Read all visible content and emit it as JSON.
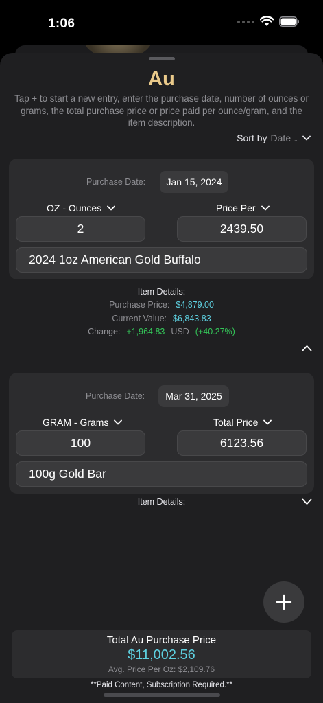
{
  "status_bar": {
    "time": "1:06"
  },
  "sheet": {
    "title": "Au",
    "instructions": "Tap + to start a new entry, enter the purchase date, number of ounces or grams, the total purchase price or price paid per ounce/gram, and the item description.",
    "sort_label": "Sort by",
    "sort_value": "Date ↓"
  },
  "entries": [
    {
      "purchase_date_label": "Purchase Date:",
      "purchase_date": "Jan 15, 2024",
      "unit": "OZ - Ounces",
      "price_mode": "Price Per",
      "quantity": "2",
      "price": "2439.50",
      "description": "2024 1oz American Gold Buffalo",
      "details": {
        "header": "Item Details:",
        "purchase_price_label": "Purchase Price:",
        "purchase_price": "$4,879.00",
        "current_value_label": "Current Value:",
        "current_value": "$6,843.83",
        "change_label": "Change:",
        "change": "+1,964.83",
        "currency": "USD",
        "change_pct": "(+40.27%)"
      }
    },
    {
      "purchase_date_label": "Purchase Date:",
      "purchase_date": "Mar 31, 2025",
      "unit": "GRAM - Grams",
      "price_mode": "Total Price",
      "quantity": "100",
      "price": "6123.56",
      "description": "100g Gold Bar",
      "details": {
        "header": "Item Details:"
      }
    }
  ],
  "footer": {
    "total_label": "Total Au Purchase Price",
    "total_value": "$11,002.56",
    "avg_label": "Avg. Price Per Oz: $2,109.76",
    "paid_note": "**Paid Content, Subscription Required.**"
  },
  "colors": {
    "accent_gold": "#e9c98a",
    "value_cyan": "#5ed0e0",
    "positive_green": "#34c759"
  }
}
